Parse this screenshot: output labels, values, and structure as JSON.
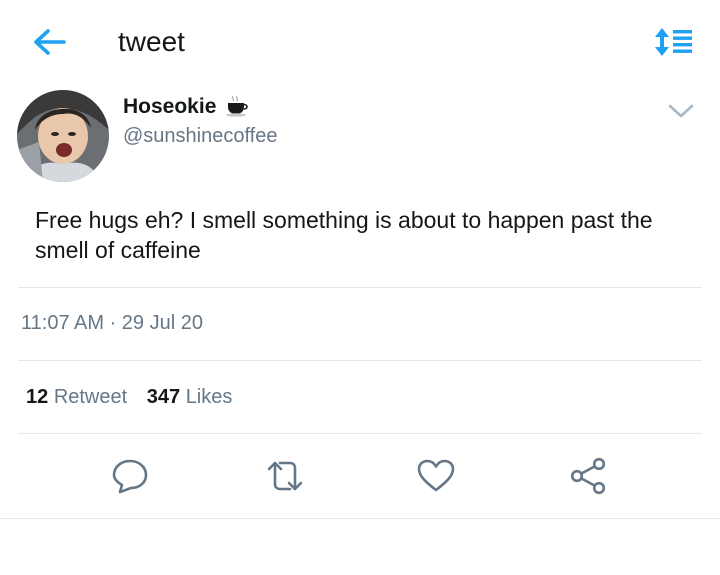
{
  "header": {
    "title": "tweet"
  },
  "tweet": {
    "display_name": "Hoseokie",
    "handle": "@sunshinecoffee",
    "text": "Free hugs eh? I smell something is about to happen past the smell of caffeine",
    "timestamp": "11:07 AM · 29 Jul 20",
    "retweet_count": "12",
    "retweet_label": "Retweet",
    "like_count": "347",
    "like_label": "Likes"
  },
  "icons": {
    "back": "arrow-left-icon",
    "sort": "sort-icon",
    "name_emoji": "coffee-icon",
    "menu": "chevron-down-icon",
    "reply": "reply-icon",
    "retweet": "retweet-icon",
    "like": "heart-icon",
    "share": "share-icon"
  },
  "colors": {
    "accent": "#1da1f2",
    "text": "#14171a",
    "secondary": "#657786",
    "divider": "#e1e8ed"
  }
}
